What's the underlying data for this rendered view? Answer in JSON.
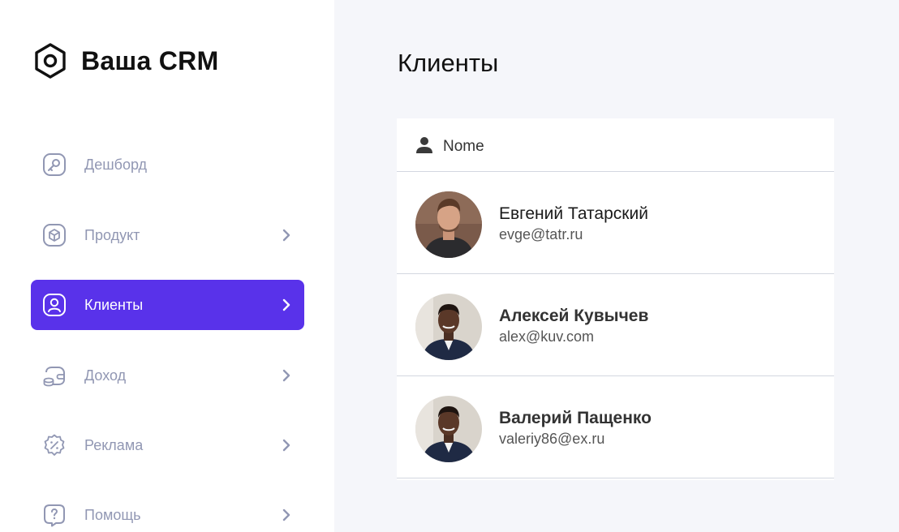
{
  "brand": {
    "title": "Ваша CRM",
    "icon": "hexagon-logo-icon"
  },
  "sidebar": {
    "items": [
      {
        "label": "Дешборд",
        "icon": "key-icon",
        "chevron": false,
        "active": false
      },
      {
        "label": "Продукт",
        "icon": "cube-icon",
        "chevron": true,
        "active": false
      },
      {
        "label": "Клиенты",
        "icon": "user-square-icon",
        "chevron": true,
        "active": true
      },
      {
        "label": "Доход",
        "icon": "wallet-icon",
        "chevron": true,
        "active": false
      },
      {
        "label": "Реклама",
        "icon": "discount-icon",
        "chevron": true,
        "active": false
      },
      {
        "label": "Помощь",
        "icon": "help-icon",
        "chevron": true,
        "active": false
      }
    ]
  },
  "main": {
    "title": "Клиенты",
    "table": {
      "header_label": "Nome",
      "rows": [
        {
          "name": "Евгений Татарский",
          "email": "evge@tatr.ru"
        },
        {
          "name": "Алексей Кувычев",
          "email": "alex@kuv.com"
        },
        {
          "name": "Валерий Пащенко",
          "email": "valeriy86@ex.ru"
        }
      ]
    }
  },
  "colors": {
    "accent": "#5932ea",
    "sidebar_text": "#9197b3",
    "background": "#f5f6fa"
  }
}
